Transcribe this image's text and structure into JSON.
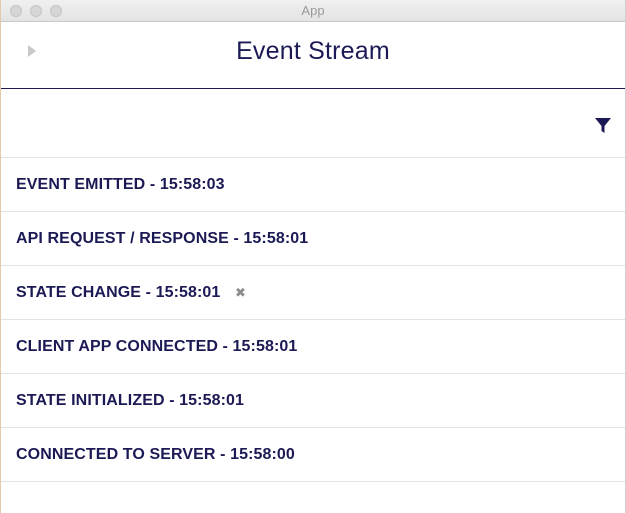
{
  "window": {
    "title": "App"
  },
  "header": {
    "title": "Event Stream"
  },
  "icons": {
    "back": "chevron-right-icon",
    "filter": "filter-funnel-icon",
    "close": "close-x-icon"
  },
  "colors": {
    "primary": "#1b1a55",
    "divider": "#e2e2e2",
    "muted": "#8c8c8c"
  },
  "events": [
    {
      "label": "EVENT EMITTED - 15:58:03"
    },
    {
      "label": "API REQUEST / RESPONSE - 15:58:01"
    },
    {
      "label": "STATE CHANGE - 15:58:01",
      "close_glyph": "✖"
    },
    {
      "label": "CLIENT APP CONNECTED - 15:58:01"
    },
    {
      "label": "STATE INITIALIZED - 15:58:01"
    },
    {
      "label": "CONNECTED TO SERVER - 15:58:00"
    }
  ]
}
